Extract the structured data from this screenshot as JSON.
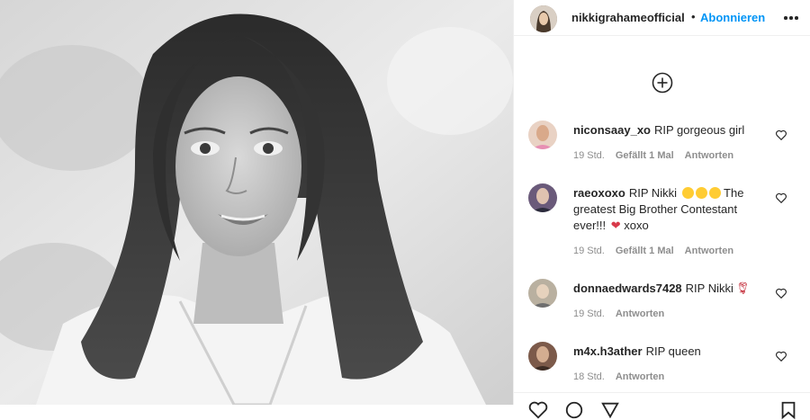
{
  "post": {
    "username": "nikkigrahameofficial",
    "separator": "•",
    "follow_label": "Abonnieren"
  },
  "comments": [
    {
      "user": "niconsaay_xo",
      "text": "RIP gorgeous girl",
      "time": "19 Std.",
      "likes": "Gefällt 1 Mal",
      "reply": "Antworten"
    },
    {
      "user": "raeoxoxo",
      "text_part1": "RIP Nikki",
      "text_part2": "The greatest Big Brother Contestant ever!!!",
      "text_part3": "xoxo",
      "time": "19 Std.",
      "likes": "Gefällt 1 Mal",
      "reply": "Antworten"
    },
    {
      "user": "donnaedwards7428",
      "text": "RIP Nikki",
      "time": "19 Std.",
      "reply": "Antworten"
    },
    {
      "user": "m4x.h3ather",
      "text": "RIP queen",
      "time": "18 Std.",
      "reply": "Antworten"
    }
  ],
  "colors": {
    "accent": "#0095f6",
    "text": "#262626",
    "muted": "#8e8e8e",
    "divider": "#efefef"
  },
  "icons": [
    "more-options-icon",
    "add-circle-icon",
    "heart-icon",
    "like-action-icon",
    "comment-action-icon",
    "share-action-icon",
    "save-action-icon"
  ]
}
